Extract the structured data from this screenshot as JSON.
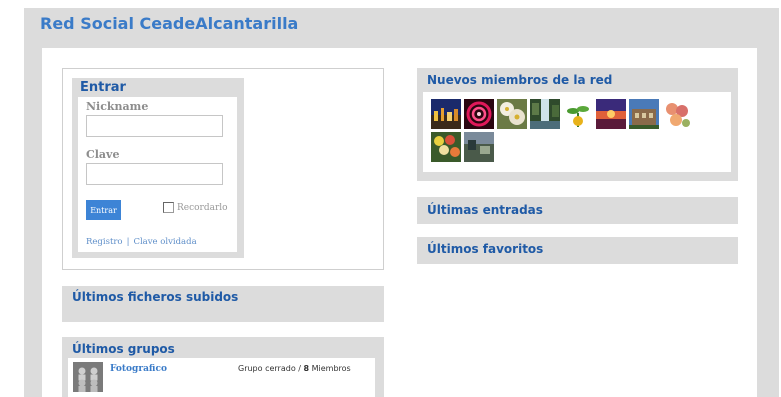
{
  "site": {
    "title": "Red Social CeadeAlcantarilla"
  },
  "login": {
    "title": "Entrar",
    "nickname_label": "Nickname",
    "nickname_value": "",
    "password_label": "Clave",
    "password_value": "",
    "submit_label": "Entrar",
    "remember_label": "Recordarlo",
    "register_link": "Registro",
    "separator": "|",
    "forgot_link": "Clave olvidada"
  },
  "sections": {
    "files_title": "Últimos ficheros subidos",
    "groups_title": "Últimos grupos",
    "members_title": "Nuevos miembros de la red",
    "entries_title": "Últimas entradas",
    "favorites_title": "Últimos favoritos"
  },
  "members": {
    "avatars": [
      "avatar-cityscape",
      "avatar-spiral",
      "avatar-flowers-white",
      "avatar-waterfall",
      "avatar-plant",
      "avatar-sunset",
      "avatar-building",
      "avatar-flowers-pink",
      "avatar-bouquet",
      "avatar-landscape"
    ]
  },
  "groups": [
    {
      "name": "Fotografico",
      "status": "Grupo cerrado /",
      "count": "8",
      "count_label": "Miembros"
    }
  ],
  "colors": {
    "accent": "#3a7bc8",
    "heading": "#1f5aa6",
    "panel": "#dcdcdc",
    "button": "#3d84d6"
  }
}
